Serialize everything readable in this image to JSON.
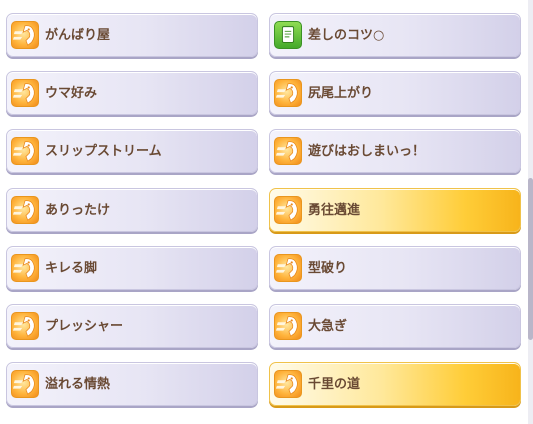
{
  "skills": [
    {
      "label": "がんばり屋",
      "highlighted": false,
      "icon": "speed-up-icon"
    },
    {
      "label": "差しのコツ○",
      "highlighted": false,
      "icon": "card-icon"
    },
    {
      "label": "ウマ好み",
      "highlighted": false,
      "icon": "speed-up-icon"
    },
    {
      "label": "尻尾上がり",
      "highlighted": false,
      "icon": "speed-up-icon"
    },
    {
      "label": "スリップストリーム",
      "highlighted": false,
      "icon": "speed-up-icon"
    },
    {
      "label": "遊びはおしまいっ！",
      "highlighted": false,
      "icon": "speed-up-icon"
    },
    {
      "label": "ありったけ",
      "highlighted": false,
      "icon": "speed-up-icon"
    },
    {
      "label": "勇往邁進",
      "highlighted": true,
      "icon": "speed-up-icon"
    },
    {
      "label": "キレる脚",
      "highlighted": false,
      "icon": "speed-up-icon"
    },
    {
      "label": "型破り",
      "highlighted": false,
      "icon": "speed-up-icon"
    },
    {
      "label": "プレッシャー",
      "highlighted": false,
      "icon": "speed-up-icon"
    },
    {
      "label": "大急ぎ",
      "highlighted": false,
      "icon": "speed-up-icon"
    },
    {
      "label": "溢れる情熱",
      "highlighted": false,
      "icon": "speed-up-icon"
    },
    {
      "label": "千里の道",
      "highlighted": true,
      "icon": "speed-up-icon"
    }
  ],
  "colors": {
    "label_text": "#6a4a34",
    "card_lavender": "#e7e5f4",
    "card_gold": "#ffcd38",
    "icon_orange": "#ffb43c",
    "icon_green": "#44a92b"
  }
}
